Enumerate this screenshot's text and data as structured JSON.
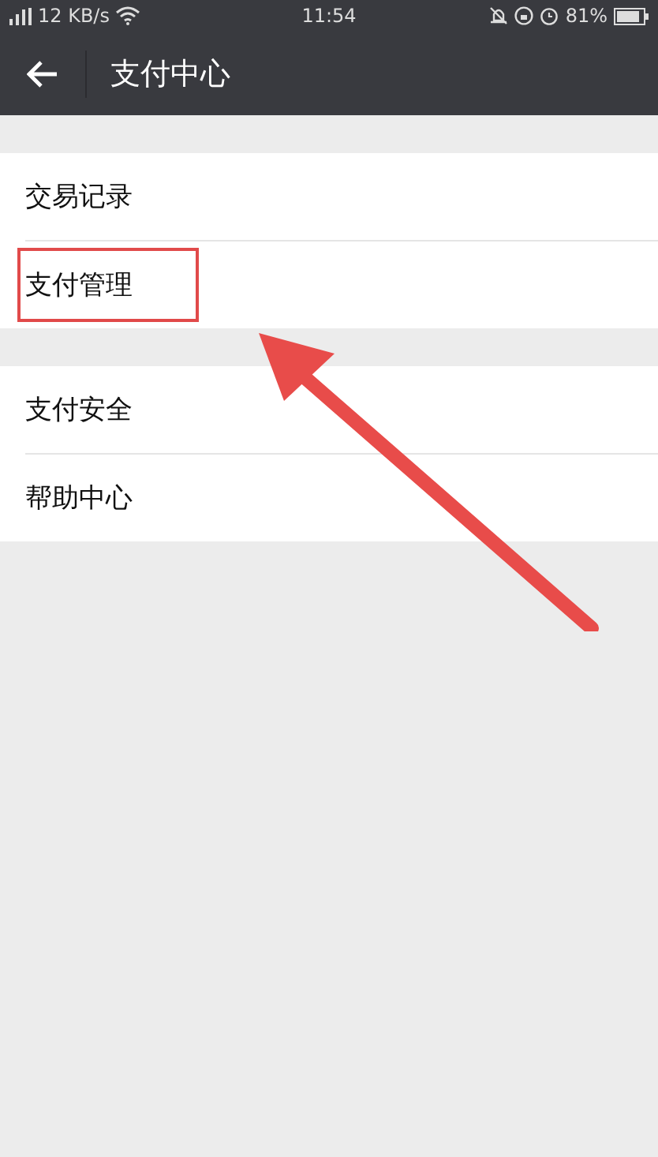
{
  "status_bar": {
    "network_speed": "12 KB/s",
    "time": "11:54",
    "battery": "81%"
  },
  "header": {
    "title": "支付中心"
  },
  "groups": [
    {
      "items": [
        {
          "label": "交易记录",
          "highlighted": false
        },
        {
          "label": "支付管理",
          "highlighted": true
        }
      ]
    },
    {
      "items": [
        {
          "label": "支付安全",
          "highlighted": false
        },
        {
          "label": "帮助中心",
          "highlighted": false
        }
      ]
    }
  ]
}
